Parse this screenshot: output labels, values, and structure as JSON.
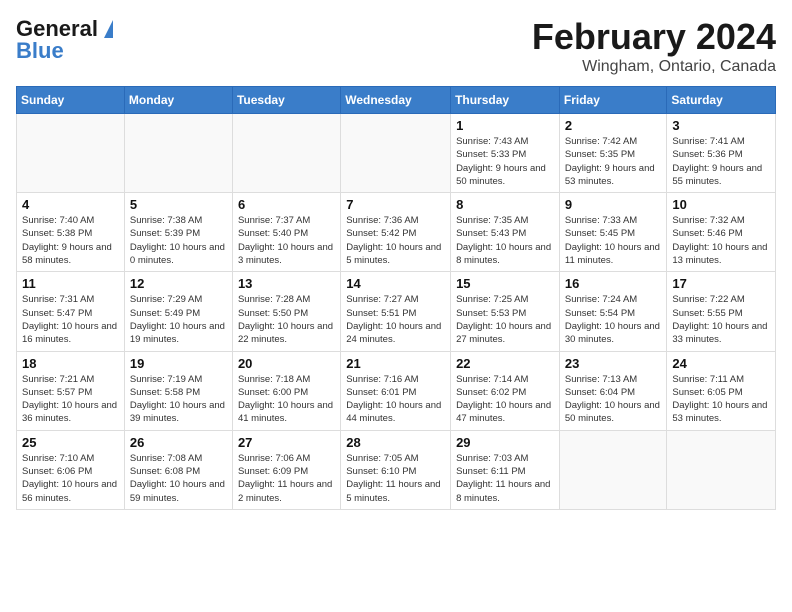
{
  "header": {
    "logo_general": "General",
    "logo_blue": "Blue",
    "month_title": "February 2024",
    "location": "Wingham, Ontario, Canada"
  },
  "weekdays": [
    "Sunday",
    "Monday",
    "Tuesday",
    "Wednesday",
    "Thursday",
    "Friday",
    "Saturday"
  ],
  "weeks": [
    [
      {
        "day": "",
        "info": ""
      },
      {
        "day": "",
        "info": ""
      },
      {
        "day": "",
        "info": ""
      },
      {
        "day": "",
        "info": ""
      },
      {
        "day": "1",
        "info": "Sunrise: 7:43 AM\nSunset: 5:33 PM\nDaylight: 9 hours and 50 minutes."
      },
      {
        "day": "2",
        "info": "Sunrise: 7:42 AM\nSunset: 5:35 PM\nDaylight: 9 hours and 53 minutes."
      },
      {
        "day": "3",
        "info": "Sunrise: 7:41 AM\nSunset: 5:36 PM\nDaylight: 9 hours and 55 minutes."
      }
    ],
    [
      {
        "day": "4",
        "info": "Sunrise: 7:40 AM\nSunset: 5:38 PM\nDaylight: 9 hours and 58 minutes."
      },
      {
        "day": "5",
        "info": "Sunrise: 7:38 AM\nSunset: 5:39 PM\nDaylight: 10 hours and 0 minutes."
      },
      {
        "day": "6",
        "info": "Sunrise: 7:37 AM\nSunset: 5:40 PM\nDaylight: 10 hours and 3 minutes."
      },
      {
        "day": "7",
        "info": "Sunrise: 7:36 AM\nSunset: 5:42 PM\nDaylight: 10 hours and 5 minutes."
      },
      {
        "day": "8",
        "info": "Sunrise: 7:35 AM\nSunset: 5:43 PM\nDaylight: 10 hours and 8 minutes."
      },
      {
        "day": "9",
        "info": "Sunrise: 7:33 AM\nSunset: 5:45 PM\nDaylight: 10 hours and 11 minutes."
      },
      {
        "day": "10",
        "info": "Sunrise: 7:32 AM\nSunset: 5:46 PM\nDaylight: 10 hours and 13 minutes."
      }
    ],
    [
      {
        "day": "11",
        "info": "Sunrise: 7:31 AM\nSunset: 5:47 PM\nDaylight: 10 hours and 16 minutes."
      },
      {
        "day": "12",
        "info": "Sunrise: 7:29 AM\nSunset: 5:49 PM\nDaylight: 10 hours and 19 minutes."
      },
      {
        "day": "13",
        "info": "Sunrise: 7:28 AM\nSunset: 5:50 PM\nDaylight: 10 hours and 22 minutes."
      },
      {
        "day": "14",
        "info": "Sunrise: 7:27 AM\nSunset: 5:51 PM\nDaylight: 10 hours and 24 minutes."
      },
      {
        "day": "15",
        "info": "Sunrise: 7:25 AM\nSunset: 5:53 PM\nDaylight: 10 hours and 27 minutes."
      },
      {
        "day": "16",
        "info": "Sunrise: 7:24 AM\nSunset: 5:54 PM\nDaylight: 10 hours and 30 minutes."
      },
      {
        "day": "17",
        "info": "Sunrise: 7:22 AM\nSunset: 5:55 PM\nDaylight: 10 hours and 33 minutes."
      }
    ],
    [
      {
        "day": "18",
        "info": "Sunrise: 7:21 AM\nSunset: 5:57 PM\nDaylight: 10 hours and 36 minutes."
      },
      {
        "day": "19",
        "info": "Sunrise: 7:19 AM\nSunset: 5:58 PM\nDaylight: 10 hours and 39 minutes."
      },
      {
        "day": "20",
        "info": "Sunrise: 7:18 AM\nSunset: 6:00 PM\nDaylight: 10 hours and 41 minutes."
      },
      {
        "day": "21",
        "info": "Sunrise: 7:16 AM\nSunset: 6:01 PM\nDaylight: 10 hours and 44 minutes."
      },
      {
        "day": "22",
        "info": "Sunrise: 7:14 AM\nSunset: 6:02 PM\nDaylight: 10 hours and 47 minutes."
      },
      {
        "day": "23",
        "info": "Sunrise: 7:13 AM\nSunset: 6:04 PM\nDaylight: 10 hours and 50 minutes."
      },
      {
        "day": "24",
        "info": "Sunrise: 7:11 AM\nSunset: 6:05 PM\nDaylight: 10 hours and 53 minutes."
      }
    ],
    [
      {
        "day": "25",
        "info": "Sunrise: 7:10 AM\nSunset: 6:06 PM\nDaylight: 10 hours and 56 minutes."
      },
      {
        "day": "26",
        "info": "Sunrise: 7:08 AM\nSunset: 6:08 PM\nDaylight: 10 hours and 59 minutes."
      },
      {
        "day": "27",
        "info": "Sunrise: 7:06 AM\nSunset: 6:09 PM\nDaylight: 11 hours and 2 minutes."
      },
      {
        "day": "28",
        "info": "Sunrise: 7:05 AM\nSunset: 6:10 PM\nDaylight: 11 hours and 5 minutes."
      },
      {
        "day": "29",
        "info": "Sunrise: 7:03 AM\nSunset: 6:11 PM\nDaylight: 11 hours and 8 minutes."
      },
      {
        "day": "",
        "info": ""
      },
      {
        "day": "",
        "info": ""
      }
    ]
  ]
}
